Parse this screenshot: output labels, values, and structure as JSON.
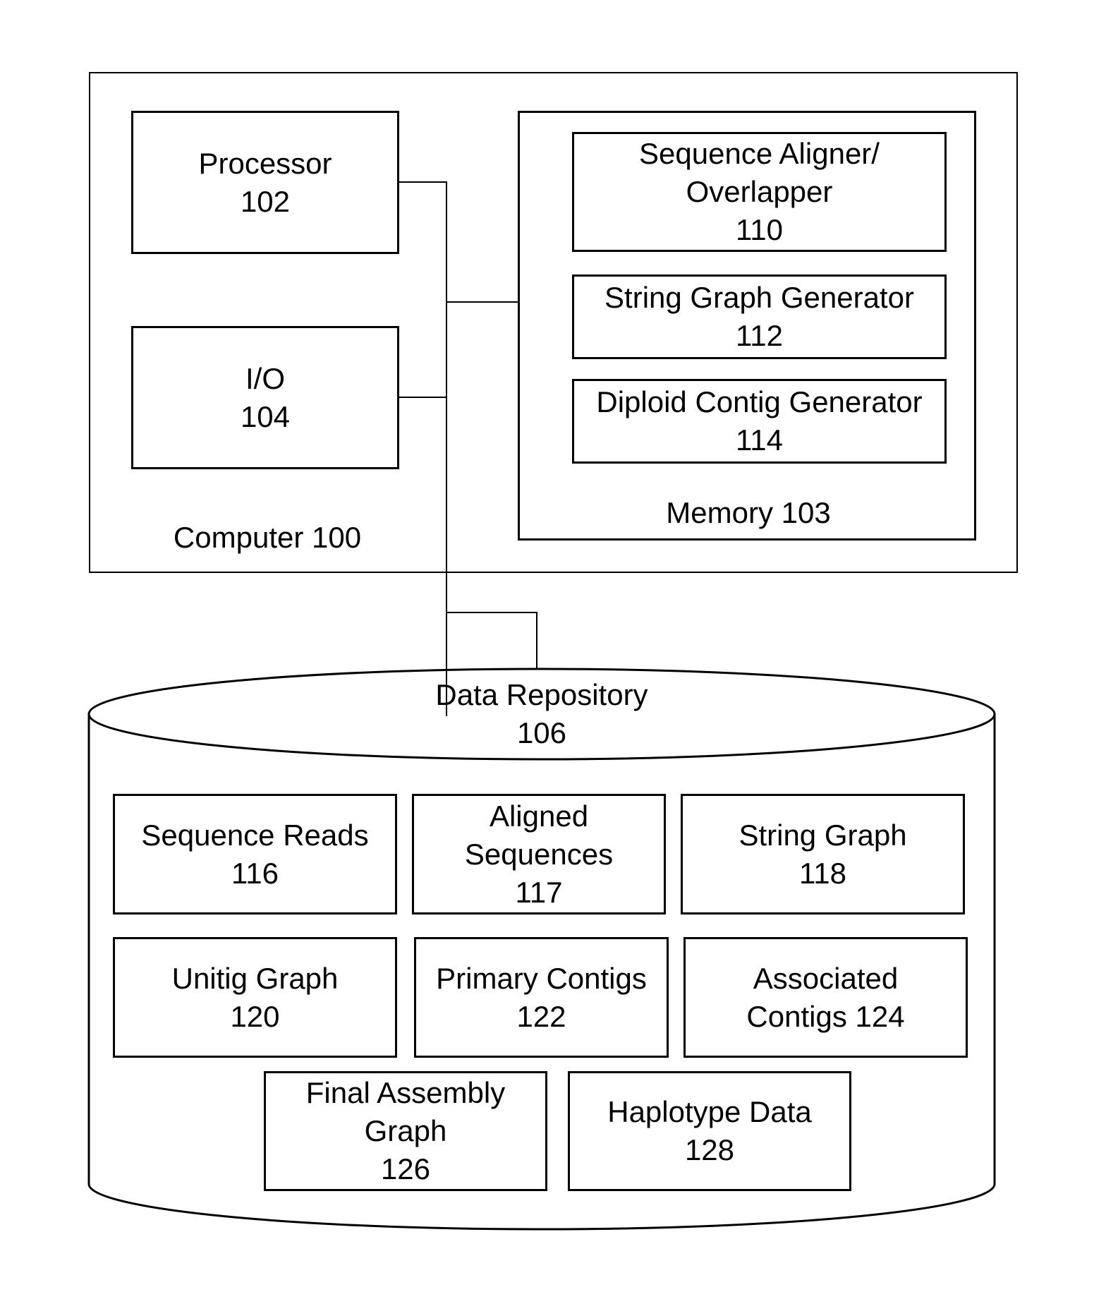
{
  "computer": {
    "label": "Computer 100",
    "processor": {
      "name": "Processor",
      "ref": "102"
    },
    "io": {
      "name": "I/O",
      "ref": "104"
    },
    "memory": {
      "label": "Memory 103",
      "modules": [
        {
          "lines": [
            "Sequence Aligner/",
            "Overlapper",
            "110"
          ]
        },
        {
          "lines": [
            "String Graph Generator",
            "112"
          ]
        },
        {
          "lines": [
            "Diploid Contig Generator",
            "114"
          ]
        }
      ]
    }
  },
  "repository": {
    "name": "Data Repository",
    "ref": "106",
    "items": [
      {
        "lines": [
          "Sequence Reads",
          "116"
        ]
      },
      {
        "lines": [
          "Aligned",
          "Sequences",
          "117"
        ]
      },
      {
        "lines": [
          "String Graph",
          "118"
        ]
      },
      {
        "lines": [
          "Unitig Graph",
          "120"
        ]
      },
      {
        "lines": [
          "Primary Contigs",
          "122"
        ]
      },
      {
        "lines": [
          "Associated",
          "Contigs 124"
        ]
      },
      {
        "lines": [
          "Final Assembly",
          "Graph",
          "126"
        ]
      },
      {
        "lines": [
          "Haplotype Data",
          "128"
        ]
      }
    ]
  }
}
